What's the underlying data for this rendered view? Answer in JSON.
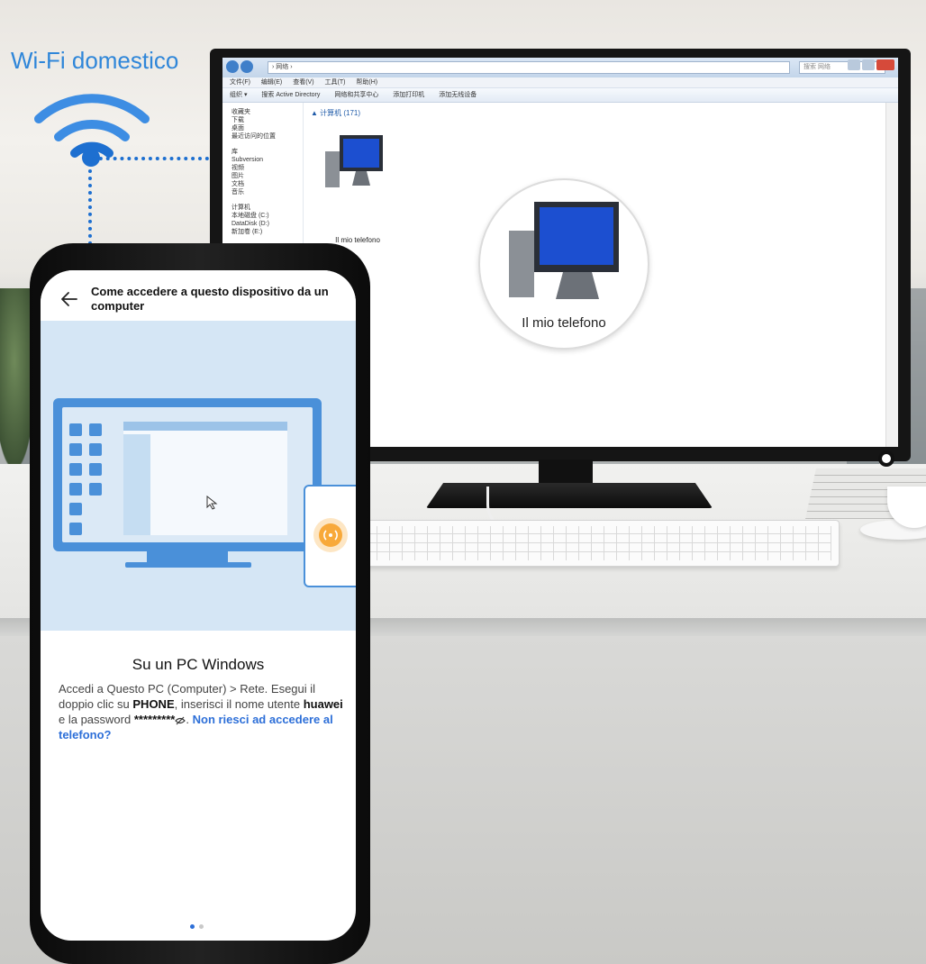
{
  "wifi": {
    "label": "Wi-Fi domestico",
    "icon": "wifi-icon",
    "accent": "#2f86d9"
  },
  "explorer": {
    "address": "› 网络 ›",
    "search_placeholder": "搜索 网络",
    "menu": [
      "文件(F)",
      "编辑(E)",
      "查看(V)",
      "工具(T)",
      "帮助(H)"
    ],
    "toolbar": [
      "组织 ▾",
      "搜索 Active Directory",
      "网络和共享中心",
      "添加打印机",
      "添加无线设备"
    ],
    "nav_pane": {
      "favorites": [
        "收藏夹",
        "下载",
        "桌面",
        "最近访问的位置"
      ],
      "libraries": [
        "库",
        "Subversion",
        "视频",
        "图片",
        "文档",
        "音乐"
      ],
      "computer": [
        "计算机",
        "本地磁盘 (C:)",
        "DataDisk (D:)",
        "新加卷 (E:)"
      ]
    },
    "group_header": "▲ 计算机 (171)",
    "device_label": "Il mio telefono",
    "zoom_label": "Il mio telefono"
  },
  "phone": {
    "back_icon": "back-arrow-icon",
    "title": "Come accedere a questo dispositivo da un computer",
    "heading": "Su un PC Windows",
    "body_parts": {
      "p1": "Accedi a Questo PC (Computer) > Rete. Esegui il doppio clic su ",
      "phone_name": "PHONE",
      "p2": ", inserisci il nome utente ",
      "username": "huawei",
      "p3": " e la password ",
      "password": "*********",
      "p4": ". ",
      "link": "Non riesci ad accedere al telefono?"
    },
    "page_indicator": {
      "current": 1,
      "total": 2
    },
    "link_color": "#2d6fd8"
  }
}
